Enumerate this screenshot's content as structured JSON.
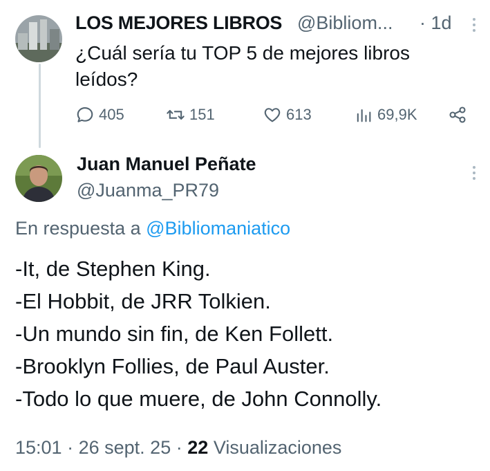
{
  "parent_tweet": {
    "author_name": "LOS MEJORES LIBROS",
    "handle": "@Bibliom...",
    "time": "· 1d",
    "text": "¿Cuál sería tu TOP 5 de mejores libros leídos?",
    "actions": {
      "replies": "405",
      "retweets": "151",
      "likes": "613",
      "views": "69,9K"
    }
  },
  "reply_tweet": {
    "author_name": "Juan Manuel Peñate",
    "handle": "@Juanma_PR79",
    "reply_prefix": "En respuesta a",
    "reply_mention": "@Bibliomaniatico",
    "lines": [
      "-It, de Stephen King.",
      "-El Hobbit, de JRR Tolkien.",
      "-Un mundo sin fin, de Ken Follett.",
      "-Brooklyn Follies, de Paul Auster.",
      "-Todo lo que muere, de John Connolly."
    ],
    "time": "15:01",
    "sep1": "·",
    "date": "26 sept. 25",
    "sep2": "·",
    "views_count": "22",
    "views_label": "Visualizaciones"
  },
  "colors": {
    "text": "#0f1419",
    "secondary": "#536471",
    "link": "#1d9bf0",
    "thread_line": "#cfd9de"
  },
  "icons": [
    "reply-icon",
    "retweet-icon",
    "like-icon",
    "views-icon",
    "share-icon",
    "more-icon"
  ]
}
